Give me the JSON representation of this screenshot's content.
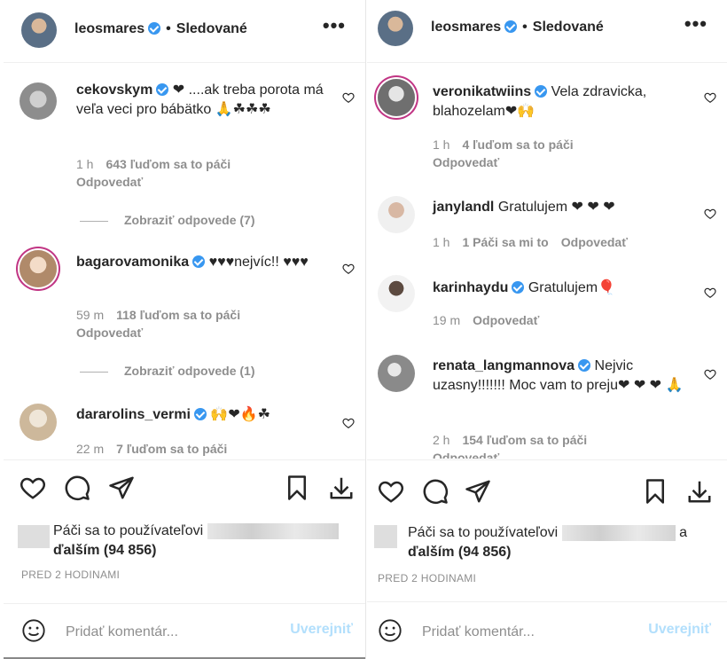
{
  "left": {
    "header": {
      "username": "leosmares",
      "dot": "•",
      "follow": "Sledované"
    },
    "comments": [
      {
        "user": "cekovskym",
        "text_a": "❤ ....ak treba porota má veľa veci pro bábätko 🙏☘☘☘",
        "time": "1 h",
        "likes": "643 ľuďom sa to páči",
        "reply": "Odpovedať"
      },
      {
        "user": "bagarovamonika",
        "text_a": "♥♥♥nejvíc!! ♥♥♥",
        "time": "59 m",
        "likes": "118 ľuďom sa to páči",
        "reply": "Odpovedať"
      },
      {
        "user": "dararolins_vermi",
        "text_a": "🙌❤🔥☘",
        "time": "22 m",
        "likes": "7 ľuďom sa to páči",
        "reply": ""
      }
    ],
    "view_replies": [
      "Zobraziť odpovede (7)",
      "Zobraziť odpovede (1)"
    ],
    "likes_line_1": "Páči sa to používateľovi",
    "likes_line_2": "ďalším (94 856)",
    "timestamp": "PRED 2 HODINAMI",
    "add_comment": {
      "placeholder": "Pridať komentár...",
      "post": "Uverejniť"
    }
  },
  "right": {
    "header": {
      "username": "leosmares",
      "dot": "•",
      "follow": "Sledované"
    },
    "comments": [
      {
        "user": "veronikatwiins",
        "text_a": "Vela zdravicka, blahozelam❤🙌",
        "time": "1 h",
        "likes": "4 ľuďom sa to páči",
        "reply": "Odpovedať"
      },
      {
        "user": "janylandl",
        "text_a": "Gratulujem ❤ ❤ ❤",
        "time": "1 h",
        "likes": "1 Páči sa mi to",
        "reply": "Odpovedať"
      },
      {
        "user": "karinhaydu",
        "text_a": "Gratulujem🎈",
        "time": "19 m",
        "likes": "",
        "reply": "Odpovedať"
      },
      {
        "user": "renata_langmannova",
        "text_a": "Nejvic uzasny!!!!!!! Moc vam to preju❤ ❤ ❤ 🙏",
        "time": "2 h",
        "likes": "154 ľuďom sa to páči",
        "reply": "Odpovedať"
      }
    ],
    "likes_line_1": "Páči sa to používateľovi",
    "likes_line_1b": "a",
    "likes_line_2": "ďalším (94 856)",
    "timestamp": "PRED 2 HODINAMI",
    "add_comment": {
      "placeholder": "Pridať komentár...",
      "post": "Uverejniť"
    }
  },
  "colors": {
    "link_blue": "#3897f0",
    "post_disabled": "#b2dffc",
    "heart_red": "#e0192f"
  },
  "icons": [
    "heart-icon",
    "comment-icon",
    "share-icon",
    "bookmark-icon",
    "download-icon",
    "emoji-icon",
    "verified-icon",
    "more-options-icon"
  ]
}
